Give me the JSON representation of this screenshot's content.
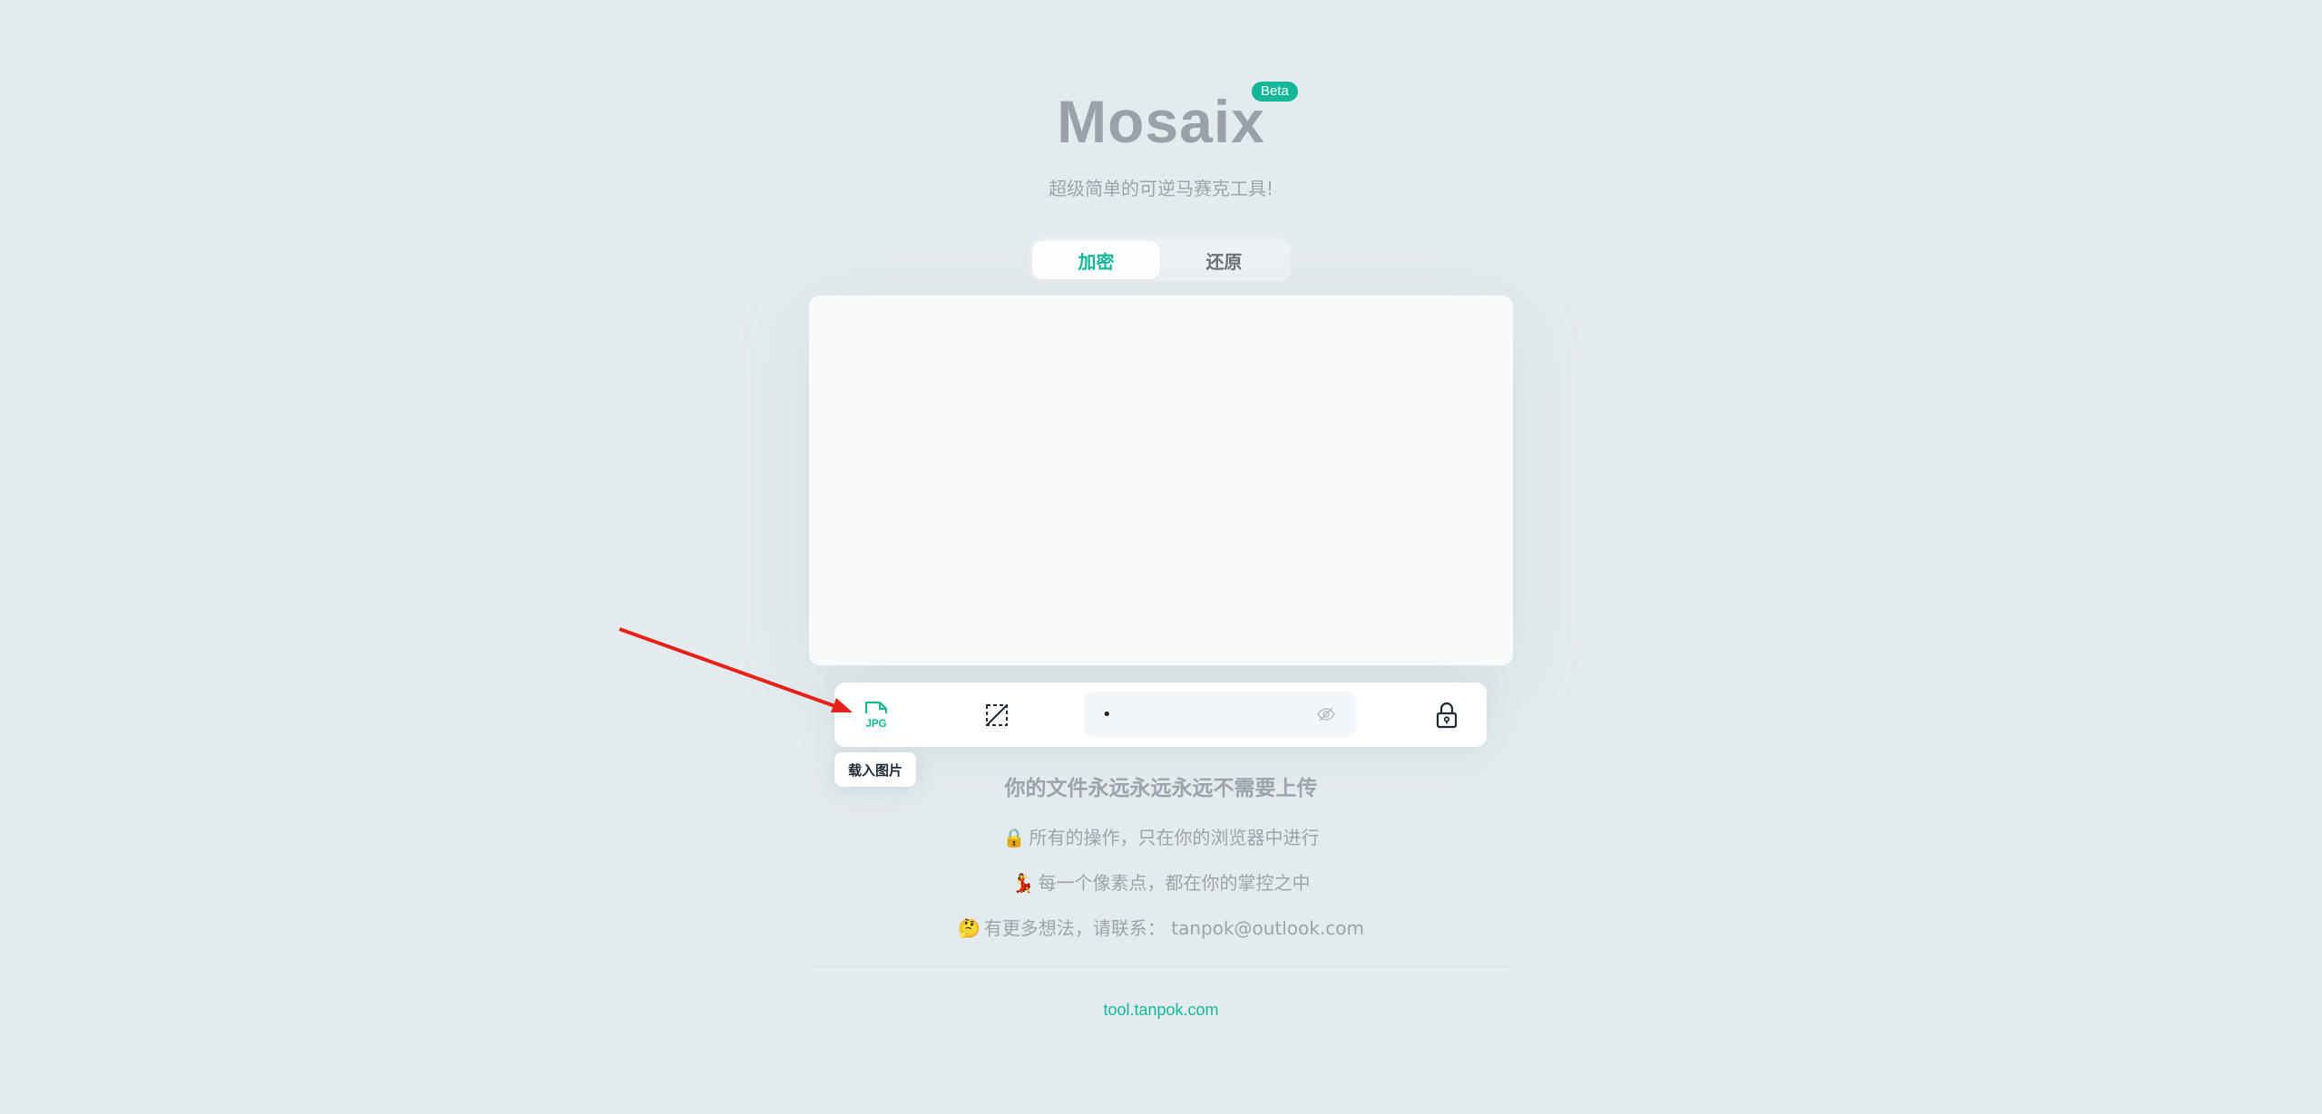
{
  "brand": {
    "title": "Mosaix",
    "badge": "Beta",
    "subtitle": "超级简单的可逆马赛克工具!"
  },
  "tabs": [
    {
      "label": "加密",
      "active": true
    },
    {
      "label": "还原",
      "active": false
    }
  ],
  "toolbar": {
    "load_icon": "jpg-file-icon",
    "select_icon": "crop-select-icon",
    "password_value": "•",
    "eye_icon": "eye-off-icon",
    "lock_icon": "lock-icon",
    "tooltip": "载入图片"
  },
  "info": {
    "headline": "你的文件永远永远永远不需要上传",
    "lines": [
      {
        "emoji": "🔒",
        "text": "所有的操作，只在你的浏览器中进行"
      },
      {
        "emoji": "💃",
        "text": "每一个像素点，都在你的掌控之中"
      },
      {
        "emoji": "🤔",
        "text": "有更多想法，请联系： tanpok@outlook.com"
      }
    ]
  },
  "footer": {
    "link": "tool.tanpok.com"
  },
  "colors": {
    "accent": "#14b898",
    "background": "#e4ebee",
    "annotation_arrow": "#e8201a"
  }
}
